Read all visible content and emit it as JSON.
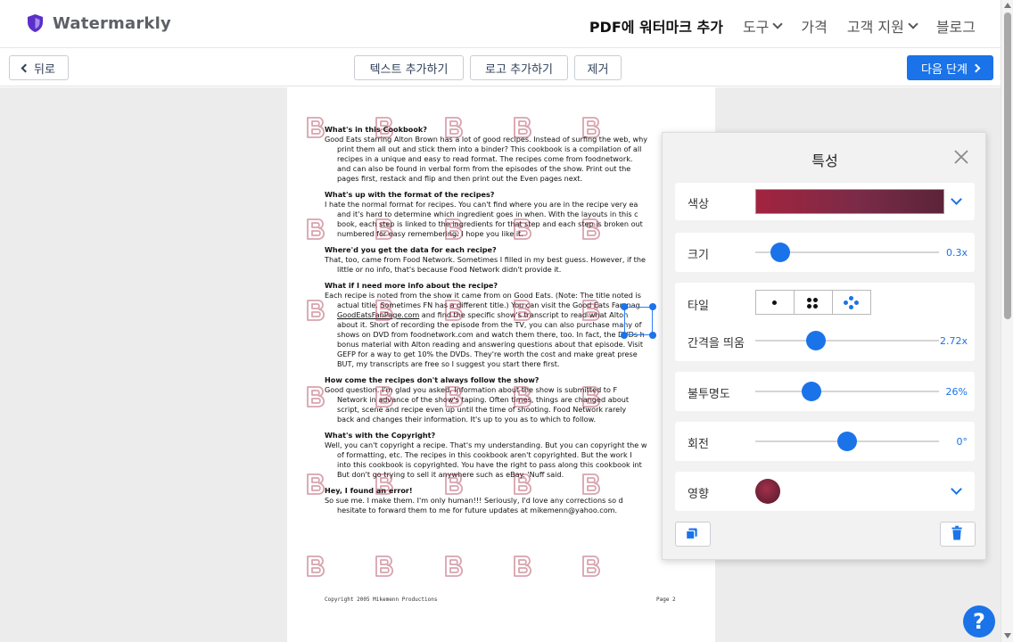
{
  "brand": {
    "name": "Watermarkly",
    "accent": "#5b2fc9"
  },
  "nav": {
    "items": [
      {
        "label": "PDF에 워터마크 추가",
        "active": true,
        "dropdown": false
      },
      {
        "label": "도구",
        "active": false,
        "dropdown": true
      },
      {
        "label": "가격",
        "active": false,
        "dropdown": false
      },
      {
        "label": "고객 지원",
        "active": false,
        "dropdown": true
      },
      {
        "label": "블로그",
        "active": false,
        "dropdown": false
      }
    ]
  },
  "toolbar": {
    "back_label": "뒤로",
    "add_text_label": "텍스트 추가하기",
    "add_logo_label": "로고 추가하기",
    "remove_label": "제거",
    "next_label": "다음 단계",
    "primary_color": "#1a73e8"
  },
  "document": {
    "sections": [
      {
        "heading": "What's in this Cookbook?",
        "lines": [
          {
            "text": "Good Eats starring Alton Brown has a lot of good recipes. Instead of surfing the web, why",
            "indent": false
          },
          {
            "text": "print them all out and stick them into a binder? This cookbook is a compilation of all",
            "indent": true
          },
          {
            "text": "recipes in a unique and easy to read format. The recipes come from foodnetwork.",
            "indent": true
          },
          {
            "text": "and can also be found in verbal form from the episodes of the show. Print out the",
            "indent": true
          },
          {
            "text": "pages first, restack and flip and then print out the Even pages next.",
            "indent": true
          }
        ]
      },
      {
        "heading": "What's up with the format of the recipes?",
        "lines": [
          {
            "text": "I hate the normal format for recipes. You can't find where you are in the recipe very ea",
            "indent": false
          },
          {
            "text": "and it's hard to determine which ingredient goes in when. With the layouts in this c",
            "indent": true
          },
          {
            "text": "book, each step is linked to the ingredients for that step and each step is broken out",
            "indent": true
          },
          {
            "text": "numbered for easy remembering. I hope you like it.",
            "indent": true
          }
        ]
      },
      {
        "heading": "Where'd you get the data for each recipe?",
        "lines": [
          {
            "text": "That, too, came from Food Network. Sometimes I filled in my best guess. However, if the",
            "indent": false
          },
          {
            "text": "little or no info, that's because Food Network didn't provide it.",
            "indent": true
          }
        ]
      },
      {
        "heading": "What if I need more info about the recipe?",
        "lines": [
          {
            "text": "Each recipe is noted from the show it came from on Good Eats. (Note: The title noted is",
            "indent": false
          },
          {
            "text": "actual title. Sometimes FN has a different title.) You can visit the Good Eats Fan pag",
            "indent": true
          },
          {
            "text": "GoodEatsFanPage.com and find the specific show's transcript to read what Alton",
            "indent": true,
            "link": true
          },
          {
            "text": "about it. Short of recording the episode from the TV, you can also purchase many of",
            "indent": true
          },
          {
            "text": "shows on DVD from foodnetwork.com and watch them there, too. In fact, the DVDs h",
            "indent": true
          },
          {
            "text": "bonus material with Alton reading and answering questions about that episode. Visit",
            "indent": true
          },
          {
            "text": "GEFP for a way to get 10% the DVDs. They're worth the cost and make great prese",
            "indent": true
          },
          {
            "text": "BUT, my transcripts are free so I suggest you start there first.",
            "indent": true
          }
        ]
      },
      {
        "heading": "How come the recipes don't always follow the show?",
        "lines": [
          {
            "text": "Good question. I'm glad you asked. Information about the show is submitted to F",
            "indent": false
          },
          {
            "text": "Network in advance of the show's taping. Often times, things are changed about",
            "indent": true
          },
          {
            "text": "script, scene and recipe even up until the time of shooting. Food Network rarely",
            "indent": true
          },
          {
            "text": "back and changes their information. It's up to you as to which to follow.",
            "indent": true
          }
        ]
      },
      {
        "heading": "What's with the Copyright?",
        "lines": [
          {
            "text": "Well, you can't copyright a recipe. That's my understanding. But you can copyright the w",
            "indent": false
          },
          {
            "text": "of formatting, etc. The recipes in this cookbook aren't copyrighted. But the work I",
            "indent": true
          },
          {
            "text": "into this cookbook is copyrighted. You have the right to pass along this cookbook int",
            "indent": true
          },
          {
            "text": "But don't go trying to sell it anywhere such as eBay. 'Nuff said.",
            "indent": true
          }
        ]
      },
      {
        "heading": "Hey, I found an error!",
        "lines": [
          {
            "text": "So sue me. I make them. I'm only human!!! Seriously, I'd love any corrections so d",
            "indent": false
          },
          {
            "text": "hesitate to forward them to me for future updates at mikemenn@yahoo.com.",
            "indent": true
          }
        ]
      }
    ],
    "footer_left": "Copyright 2005 Mikemenn Productions",
    "footer_right": "Page 2",
    "watermark_letter": "B"
  },
  "properties": {
    "title": "특성",
    "color_label": "색상",
    "watermark_color": "#a3233f",
    "size_label": "크기",
    "size_value": "0.3x",
    "size_level": 0.09,
    "tile_label": "타일",
    "tile_options": [
      "single-dot",
      "four-dots",
      "diamond-dots"
    ],
    "tile_selected": 2,
    "spacing_label": "간격을 띄움",
    "spacing_value": "2.72x",
    "spacing_level": 0.31,
    "opacity_label": "불투명도",
    "opacity_value": "26%",
    "opacity_level": 0.28,
    "rotation_label": "회전",
    "rotation_value": "0°",
    "rotation_level": 0.5,
    "effect_label": "영향"
  },
  "help": {
    "label": "?"
  }
}
